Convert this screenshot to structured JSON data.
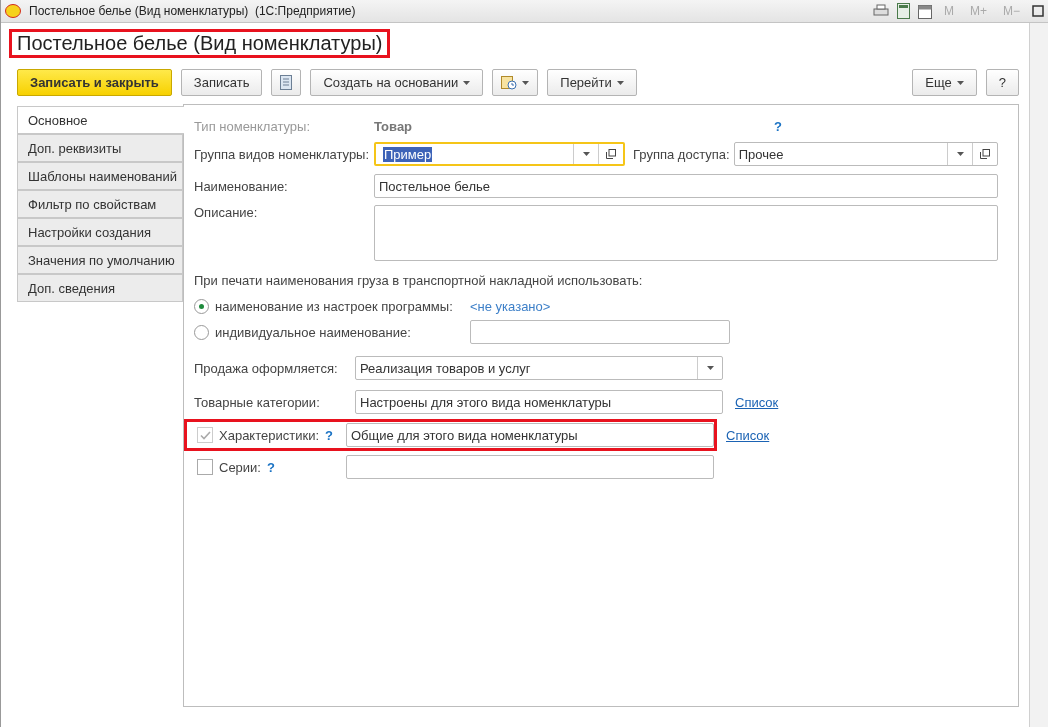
{
  "window": {
    "title": "Постельное белье (Вид номенклатуры)  (1С:Предприятие)",
    "memory_keys": [
      "M",
      "M+",
      "M−"
    ]
  },
  "header": {
    "title": "Постельное белье (Вид номенклатуры)",
    "highlighted": true
  },
  "toolbar": [
    {
      "kind": "primary",
      "label": "Записать и закрыть"
    },
    {
      "kind": "plain",
      "label": "Записать"
    },
    {
      "kind": "list-icon"
    },
    {
      "kind": "menu",
      "label": "Создать на основании"
    },
    {
      "kind": "report-menu"
    },
    {
      "kind": "menu",
      "label": "Перейти"
    }
  ],
  "toolbar_right": [
    {
      "kind": "menu",
      "label": "Еще"
    },
    {
      "kind": "plain",
      "label": "?"
    }
  ],
  "tabs": [
    {
      "label": "Основное",
      "selected": true
    },
    {
      "label": "Доп. реквизиты",
      "selected": false
    },
    {
      "label": "Шаблоны наименований",
      "selected": false
    },
    {
      "label": "Фильтр по свойствам",
      "selected": false
    },
    {
      "label": "Настройки создания",
      "selected": false
    },
    {
      "label": "Значения по умолчанию",
      "selected": false
    },
    {
      "label": "Доп. сведения",
      "selected": false
    }
  ],
  "form": {
    "type_label": "Тип номенклатуры:",
    "type_value": "Товар",
    "help": "?",
    "group": {
      "label": "Группа видов номенклатуры:",
      "value": "Пример",
      "focused": true
    },
    "access": {
      "label": "Группа доступа:",
      "value": "Прочее"
    },
    "name": {
      "label": "Наименование:",
      "value": "Постельное белье"
    },
    "description": {
      "label": "Описание:"
    },
    "print_caption": "При печати наименования груза в транспортной накладной использовать:",
    "print_options": [
      {
        "label": "наименование из настроек программы:",
        "selected": true,
        "link": "<не указано>"
      },
      {
        "label": "индивидуальное наименование:",
        "selected": false
      }
    ],
    "sale": {
      "label": "Продажа оформляется:",
      "value": "Реализация товаров и услуг"
    },
    "categories": {
      "label": "Товарные категории:",
      "value": "Настроены для этого вида номенклатуры",
      "link": "Список"
    },
    "options": [
      {
        "label": "Характеристики:",
        "checked": true,
        "disabled": true,
        "help": "?",
        "value": "Общие для этого вида номенклатуры",
        "link": "Список",
        "highlighted": true
      },
      {
        "label": "Серии:",
        "checked": false,
        "disabled": false,
        "help": "?",
        "highlighted": false
      }
    ]
  }
}
